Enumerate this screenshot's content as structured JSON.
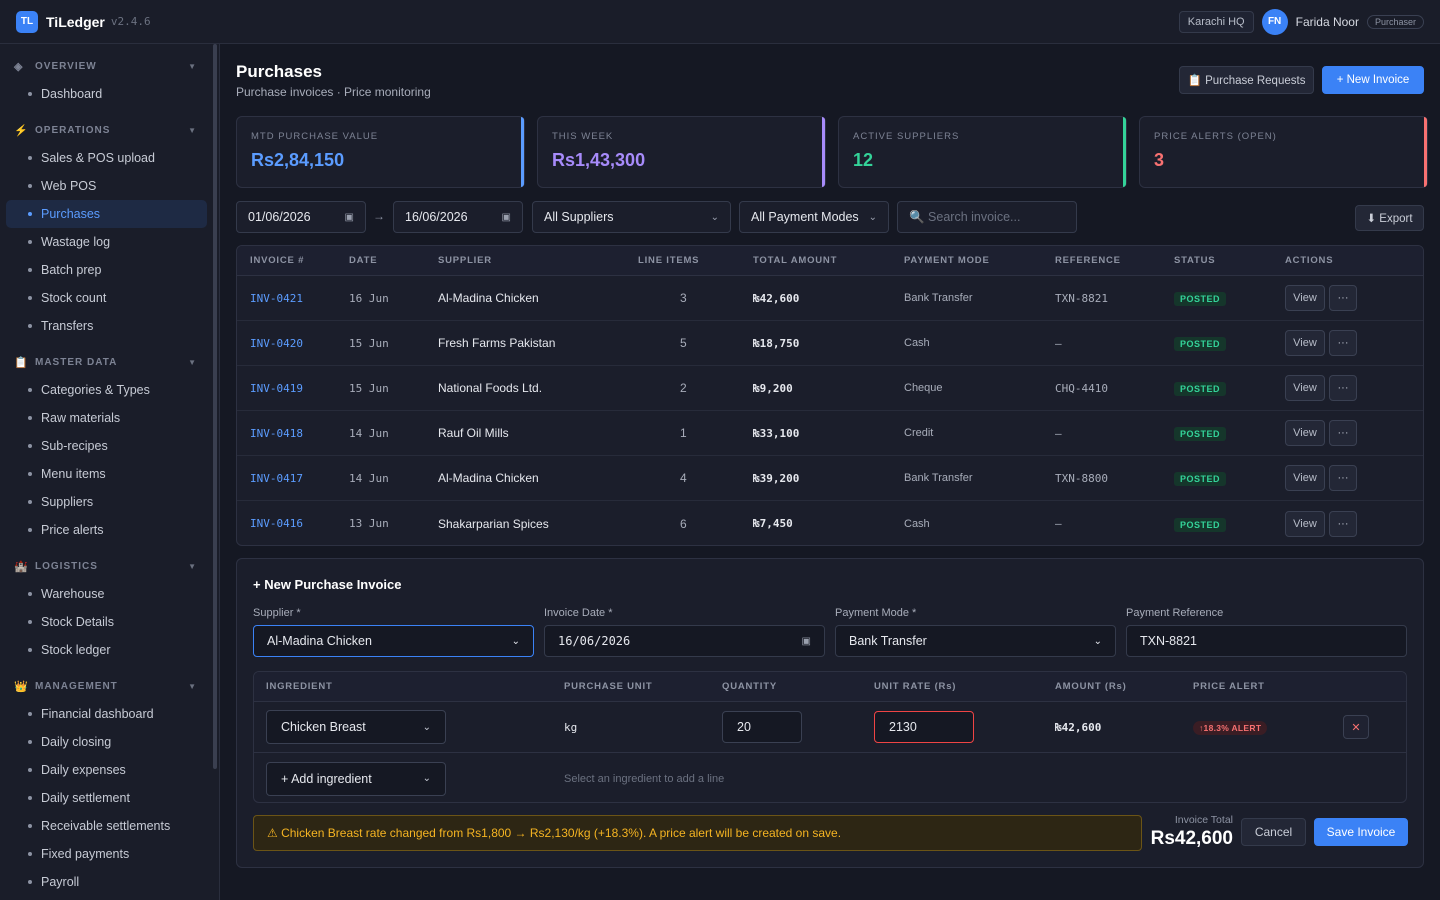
{
  "app": {
    "logo": "TL",
    "name": "TiLedger",
    "version": "v2.4.6"
  },
  "topbar": {
    "location": "Karachi HQ",
    "avatar_initials": "FN",
    "user_name": "Farida Noor",
    "role": "Purchaser"
  },
  "sidebar": {
    "groups": [
      {
        "icon": "◈",
        "label": "OVERVIEW",
        "items": [
          "Dashboard"
        ]
      },
      {
        "icon": "⚡",
        "label": "OPERATIONS",
        "items": [
          "Sales & POS upload",
          "Web POS",
          "Purchases",
          "Wastage log",
          "Batch prep",
          "Stock count",
          "Transfers"
        ]
      },
      {
        "icon": "📋",
        "label": "MASTER DATA",
        "items": [
          "Categories & Types",
          "Raw materials",
          "Sub-recipes",
          "Menu items",
          "Suppliers",
          "Price alerts"
        ]
      },
      {
        "icon": "🏰",
        "label": "LOGISTICS",
        "items": [
          "Warehouse",
          "Stock Details",
          "Stock ledger"
        ]
      },
      {
        "icon": "👑",
        "label": "MANAGEMENT",
        "items": [
          "Financial dashboard",
          "Daily closing",
          "Daily expenses",
          "Daily settlement",
          "Receivable settlements",
          "Fixed payments",
          "Payroll"
        ]
      }
    ],
    "active_item": "Purchases"
  },
  "page": {
    "title": "Purchases",
    "subtitle": "Purchase invoices · Price monitoring",
    "purchase_requests_label": "📋 Purchase Requests",
    "new_invoice_label": "+ New Invoice"
  },
  "kpis": [
    {
      "label": "MTD PURCHASE VALUE",
      "value": "Rs2,84,150",
      "color": "#5b9cff"
    },
    {
      "label": "THIS WEEK",
      "value": "Rs1,43,300",
      "color": "#a78bfa"
    },
    {
      "label": "ACTIVE SUPPLIERS",
      "value": "12",
      "color": "#34d399"
    },
    {
      "label": "PRICE ALERTS (OPEN)",
      "value": "3",
      "color": "#f87171"
    }
  ],
  "filters": {
    "date_from": "01/06/2026",
    "arrow": "→",
    "date_to": "16/06/2026",
    "supplier": "All Suppliers",
    "payment_mode": "All Payment Modes",
    "search_placeholder": "🔍 Search invoice...",
    "export_label": "⬇ Export"
  },
  "table": {
    "headers": [
      "INVOICE #",
      "DATE",
      "SUPPLIER",
      "LINE ITEMS",
      "TOTAL AMOUNT",
      "PAYMENT MODE",
      "REFERENCE",
      "STATUS",
      "ACTIONS"
    ],
    "rows": [
      {
        "invoice": "INV-0421",
        "date": "16 Jun",
        "supplier": "Al-Madina Chicken",
        "lines": "3",
        "total": "₨42,600",
        "mode": "Bank Transfer",
        "ref": "TXN-8821",
        "status": "POSTED"
      },
      {
        "invoice": "INV-0420",
        "date": "15 Jun",
        "supplier": "Fresh Farms Pakistan",
        "lines": "5",
        "total": "₨18,750",
        "mode": "Cash",
        "ref": "—",
        "status": "POSTED"
      },
      {
        "invoice": "INV-0419",
        "date": "15 Jun",
        "supplier": "National Foods Ltd.",
        "lines": "2",
        "total": "₨9,200",
        "mode": "Cheque",
        "ref": "CHQ-4410",
        "status": "POSTED"
      },
      {
        "invoice": "INV-0418",
        "date": "14 Jun",
        "supplier": "Rauf Oil Mills",
        "lines": "1",
        "total": "₨33,100",
        "mode": "Credit",
        "ref": "—",
        "status": "POSTED"
      },
      {
        "invoice": "INV-0417",
        "date": "14 Jun",
        "supplier": "Al-Madina Chicken",
        "lines": "4",
        "total": "₨39,200",
        "mode": "Bank Transfer",
        "ref": "TXN-8800",
        "status": "POSTED"
      },
      {
        "invoice": "INV-0416",
        "date": "13 Jun",
        "supplier": "Shakarparian Spices",
        "lines": "6",
        "total": "₨7,450",
        "mode": "Cash",
        "ref": "—",
        "status": "POSTED"
      }
    ],
    "view_label": "View",
    "more_label": "···"
  },
  "form": {
    "title": "+ New Purchase Invoice",
    "supplier_label": "Supplier *",
    "supplier_value": "Al-Madina Chicken",
    "date_label": "Invoice Date *",
    "date_value": "16/06/2026",
    "mode_label": "Payment Mode *",
    "mode_value": "Bank Transfer",
    "ref_label": "Payment Reference",
    "ref_value": "TXN-8821",
    "lines_headers": [
      "INGREDIENT",
      "PURCHASE UNIT",
      "QUANTITY",
      "UNIT RATE (Rs)",
      "AMOUNT (Rs)",
      "PRICE ALERT"
    ],
    "line": {
      "ingredient": "Chicken Breast",
      "unit": "kg",
      "quantity": "20",
      "rate": "2130",
      "amount": "₨42,600",
      "alert": "↑18.3% ALERT",
      "remove": "✕"
    },
    "add_ingredient": "+ Add ingredient",
    "add_hint": "Select an ingredient to add a line",
    "warning": "⚠ Chicken Breast rate changed from Rs1,800 → Rs2,130/kg (+18.3%). A price alert will be created on save.",
    "total_label": "Invoice Total",
    "total_value": "Rs42,600",
    "cancel_label": "Cancel",
    "save_label": "Save Invoice"
  }
}
